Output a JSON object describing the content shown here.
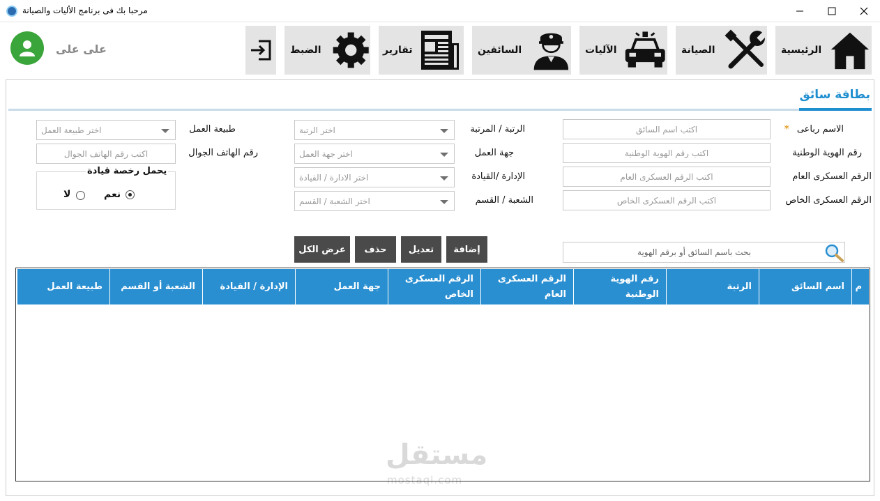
{
  "window": {
    "title": "مرحبا بك فى برنامج الأليات والصيانة"
  },
  "user": {
    "name": "على على"
  },
  "nav": {
    "home": "الرئيسية",
    "maintenance": "الصيانة",
    "vehicles": "الآليات",
    "drivers": "السائقين",
    "reports": "تقارير",
    "settings": "الضبط"
  },
  "form": {
    "title": "بطاقة سائق",
    "full_name_label": "الاسم رباعى",
    "required_mark": "*",
    "full_name_placeholder": "اكتب اسم السائق",
    "national_id_label": "رقم الهوية الوطنية",
    "national_id_placeholder": "اكتب رقم الهوية الوطنية",
    "general_military_label": "الرقم العسكرى العام",
    "general_military_placeholder": "اكتب الرقم العسكرى العام",
    "special_military_label": "الرقم العسكرى الخاص",
    "special_military_placeholder": "اكتب الرقم العسكرى الخاص",
    "rank_label": "الرتبة / المرتبة",
    "rank_value": "اختر الرتبة",
    "work_entity_label": "جهة العمل",
    "work_entity_value": "اختر جهة العمل",
    "directorate_label": "الإدارة /القيادة",
    "directorate_value": "اختر الادارة / القيادة",
    "section_label": "الشعبة / القسم",
    "section_value": "اختر الشعبة / القسم",
    "work_nature_label": "طبيعة العمل",
    "work_nature_value": "اختر طبيعة العمل",
    "mobile_label": "رقم الهاتف الجوال",
    "mobile_placeholder": "اكتب رقم الهاتف الجوال",
    "license_group_title": "يحمل رخصة قيادة",
    "license_yes": "نعم",
    "license_no": "لا",
    "license_selected": "yes"
  },
  "actions": {
    "add": "إضافة",
    "edit": "تعديل",
    "delete": "حذف",
    "show_all": "عرض الكل"
  },
  "search": {
    "placeholder": "بحث باسم السائق أو برقم الهوية"
  },
  "table": {
    "columns": [
      "م",
      "اسم السائق",
      "الرتبة",
      "رقم الهوية الوطنية",
      "الرقم العسكرى العام",
      "الرقم العسكرى الخاص",
      "جهة العمل",
      "الإدارة / القيادة",
      "الشعبة أو القسم",
      "طبيعة العمل"
    ],
    "rows": []
  },
  "watermark": {
    "main": "مستقل",
    "sub": "mostaql.com"
  },
  "colors": {
    "accent": "#1f8fd0",
    "header_bg": "#2a8fd1",
    "button_bg": "#4a4a4a",
    "avatar_bg": "#3aa53a",
    "nav_bg": "#e4e4e4"
  }
}
